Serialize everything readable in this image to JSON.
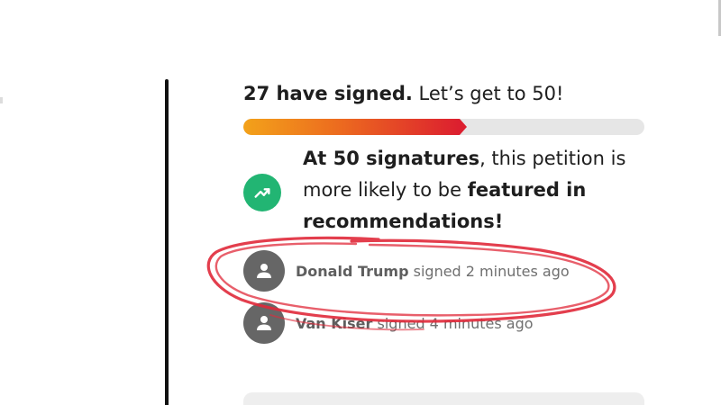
{
  "progress": {
    "signed_count_text": "27 have signed.",
    "goal_text": "Let’s get to 50!",
    "fraction": 0.54,
    "gradient_start": "#f3a21a",
    "gradient_end": "#dc1f2f",
    "track_color": "#e6e6e6"
  },
  "milestone": {
    "icon": "trending-up-icon",
    "icon_color": "#22b573",
    "bold_lead": "At 50 signatures",
    "middle_text": ", this petition is more likely to be ",
    "bold_tail": "featured in recommendations!"
  },
  "signers": [
    {
      "name": "Donald Trump",
      "activity": "signed 2 minutes ago",
      "icon": "user-avatar-icon"
    },
    {
      "name": "Van Kiser",
      "activity": "signed 4 minutes ago",
      "icon": "user-avatar-icon"
    }
  ],
  "annotation": {
    "color": "#e0293a",
    "shape": "hand-drawn circle around first signer"
  }
}
